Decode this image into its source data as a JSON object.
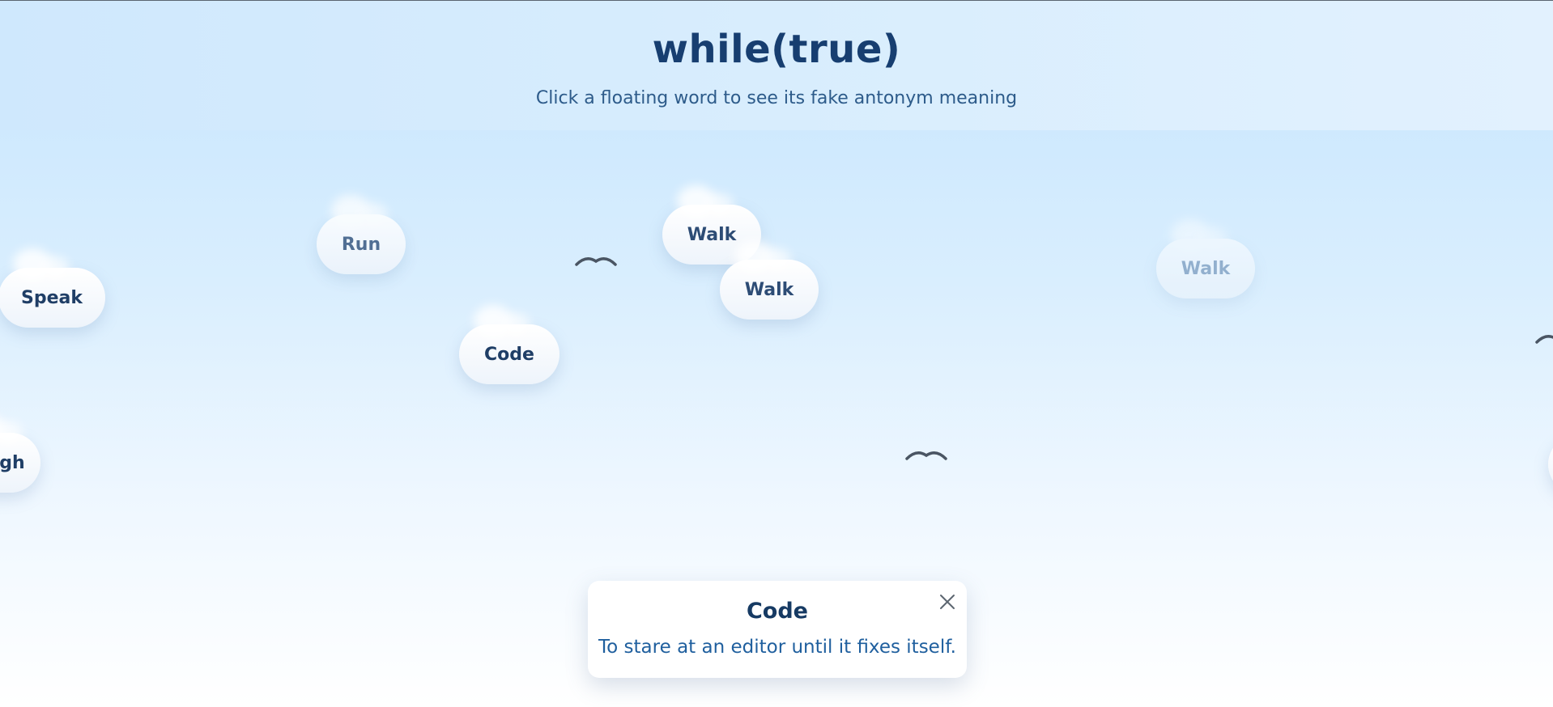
{
  "header": {
    "title": "while(true)",
    "subtitle": "Click a floating word to see its fake antonym meaning"
  },
  "clouds": [
    {
      "word": "Speak"
    },
    {
      "word": "Run"
    },
    {
      "word": "Code"
    },
    {
      "word": "Walk"
    },
    {
      "word": "Walk"
    },
    {
      "word": "Walk"
    },
    {
      "word": "gh"
    }
  ],
  "popup": {
    "word": "Code",
    "meaning": "To stare at an editor until it fixes itself.",
    "close_icon": "close-icon"
  },
  "colors": {
    "title": "#173e70",
    "subtitle": "#2d5b8a",
    "meaning": "#1f5f9e",
    "bird": "#4a5563"
  }
}
